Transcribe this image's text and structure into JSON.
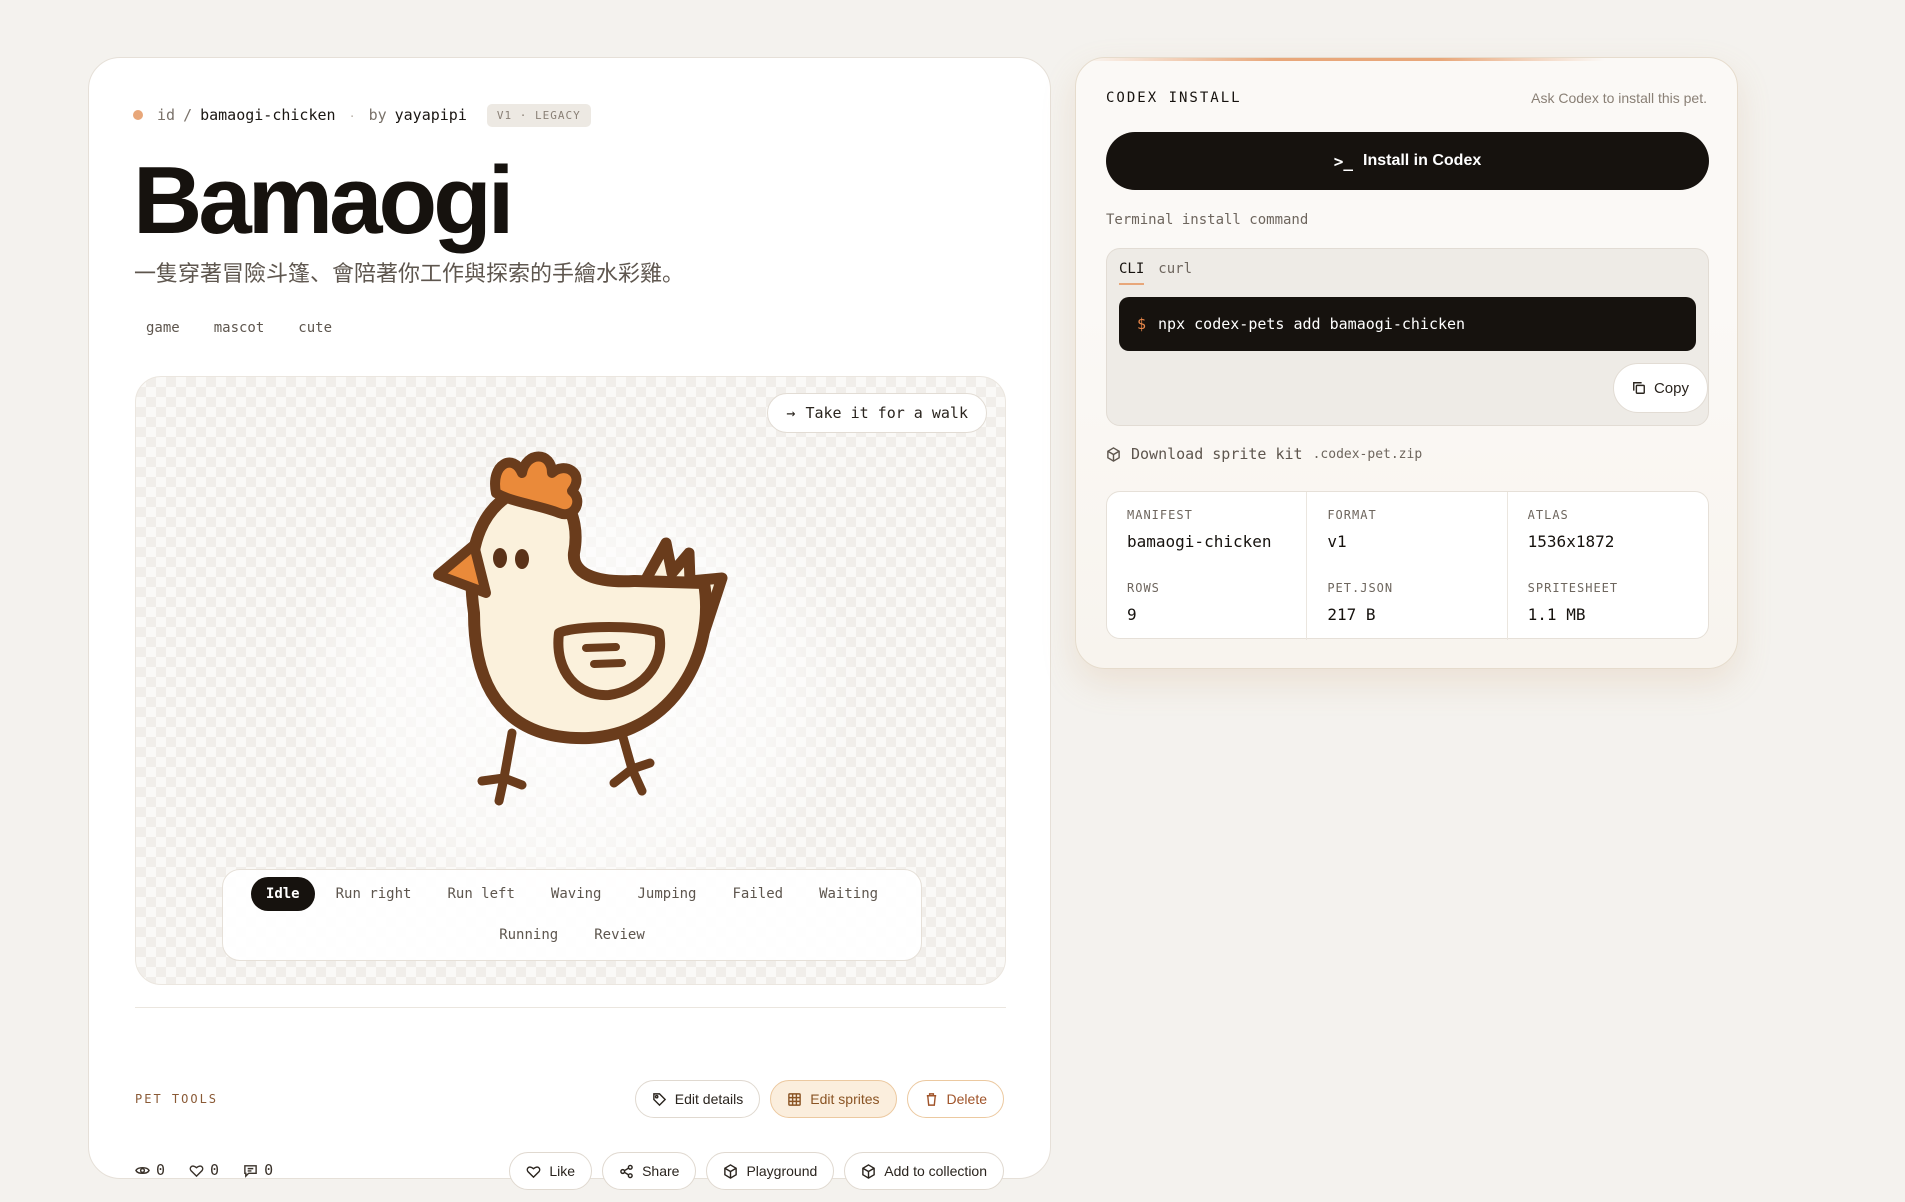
{
  "pet": {
    "id_label": "id",
    "id_slash": "/",
    "id": "bamaogi-chicken",
    "by_label": "by",
    "author": "yayapipi",
    "version_badge": "V1 · LEGACY",
    "name": "Bamaogi",
    "description": "一隻穿著冒險斗篷、會陪著你工作與探索的手繪水彩雞。",
    "tags": [
      "game",
      "mascot",
      "cute"
    ]
  },
  "stage": {
    "walk_button": "Take it for a walk",
    "animations_row1": [
      "Idle",
      "Run right",
      "Run left",
      "Waving",
      "Jumping",
      "Failed",
      "Waiting"
    ],
    "animations_row2": [
      "Running",
      "Review"
    ],
    "active_animation": "Idle"
  },
  "tools": {
    "label": "PET TOOLS",
    "edit_details": "Edit details",
    "edit_sprites": "Edit sprites",
    "delete": "Delete"
  },
  "stats": {
    "views": "0",
    "likes": "0",
    "comments": "0"
  },
  "social": {
    "like": "Like",
    "share": "Share",
    "playground": "Playground",
    "add_to_collection": "Add to collection"
  },
  "install": {
    "title": "CODEX INSTALL",
    "hint": "Ask Codex to install this pet.",
    "install_button": "Install in Codex",
    "terminal_label": "Terminal install command",
    "tabs": [
      "CLI",
      "curl"
    ],
    "active_tab": "CLI",
    "prompt": "$",
    "command": "npx codex-pets add bamaogi-chicken",
    "copy": "Copy",
    "download_label": "Download sprite kit",
    "download_ext": ".codex-pet.zip"
  },
  "manifest": {
    "manifest_label": "MANIFEST",
    "manifest_value": "bamaogi-chicken",
    "format_label": "FORMAT",
    "format_value": "v1",
    "atlas_label": "ATLAS",
    "atlas_value": "1536x1872",
    "rows_label": "ROWS",
    "rows_value": "9",
    "petjson_label": "PET.JSON",
    "petjson_value": "217 B",
    "spritesheet_label": "SPRITESHEET",
    "spritesheet_value": "1.1 MB"
  },
  "colors": {
    "accent": "#e8a77a",
    "dark": "#16120e",
    "background": "#f4f2ee",
    "chicken_outline": "#6a3c1c",
    "chicken_body": "#fbf1dc",
    "chicken_comb": "#ea8a3a"
  }
}
